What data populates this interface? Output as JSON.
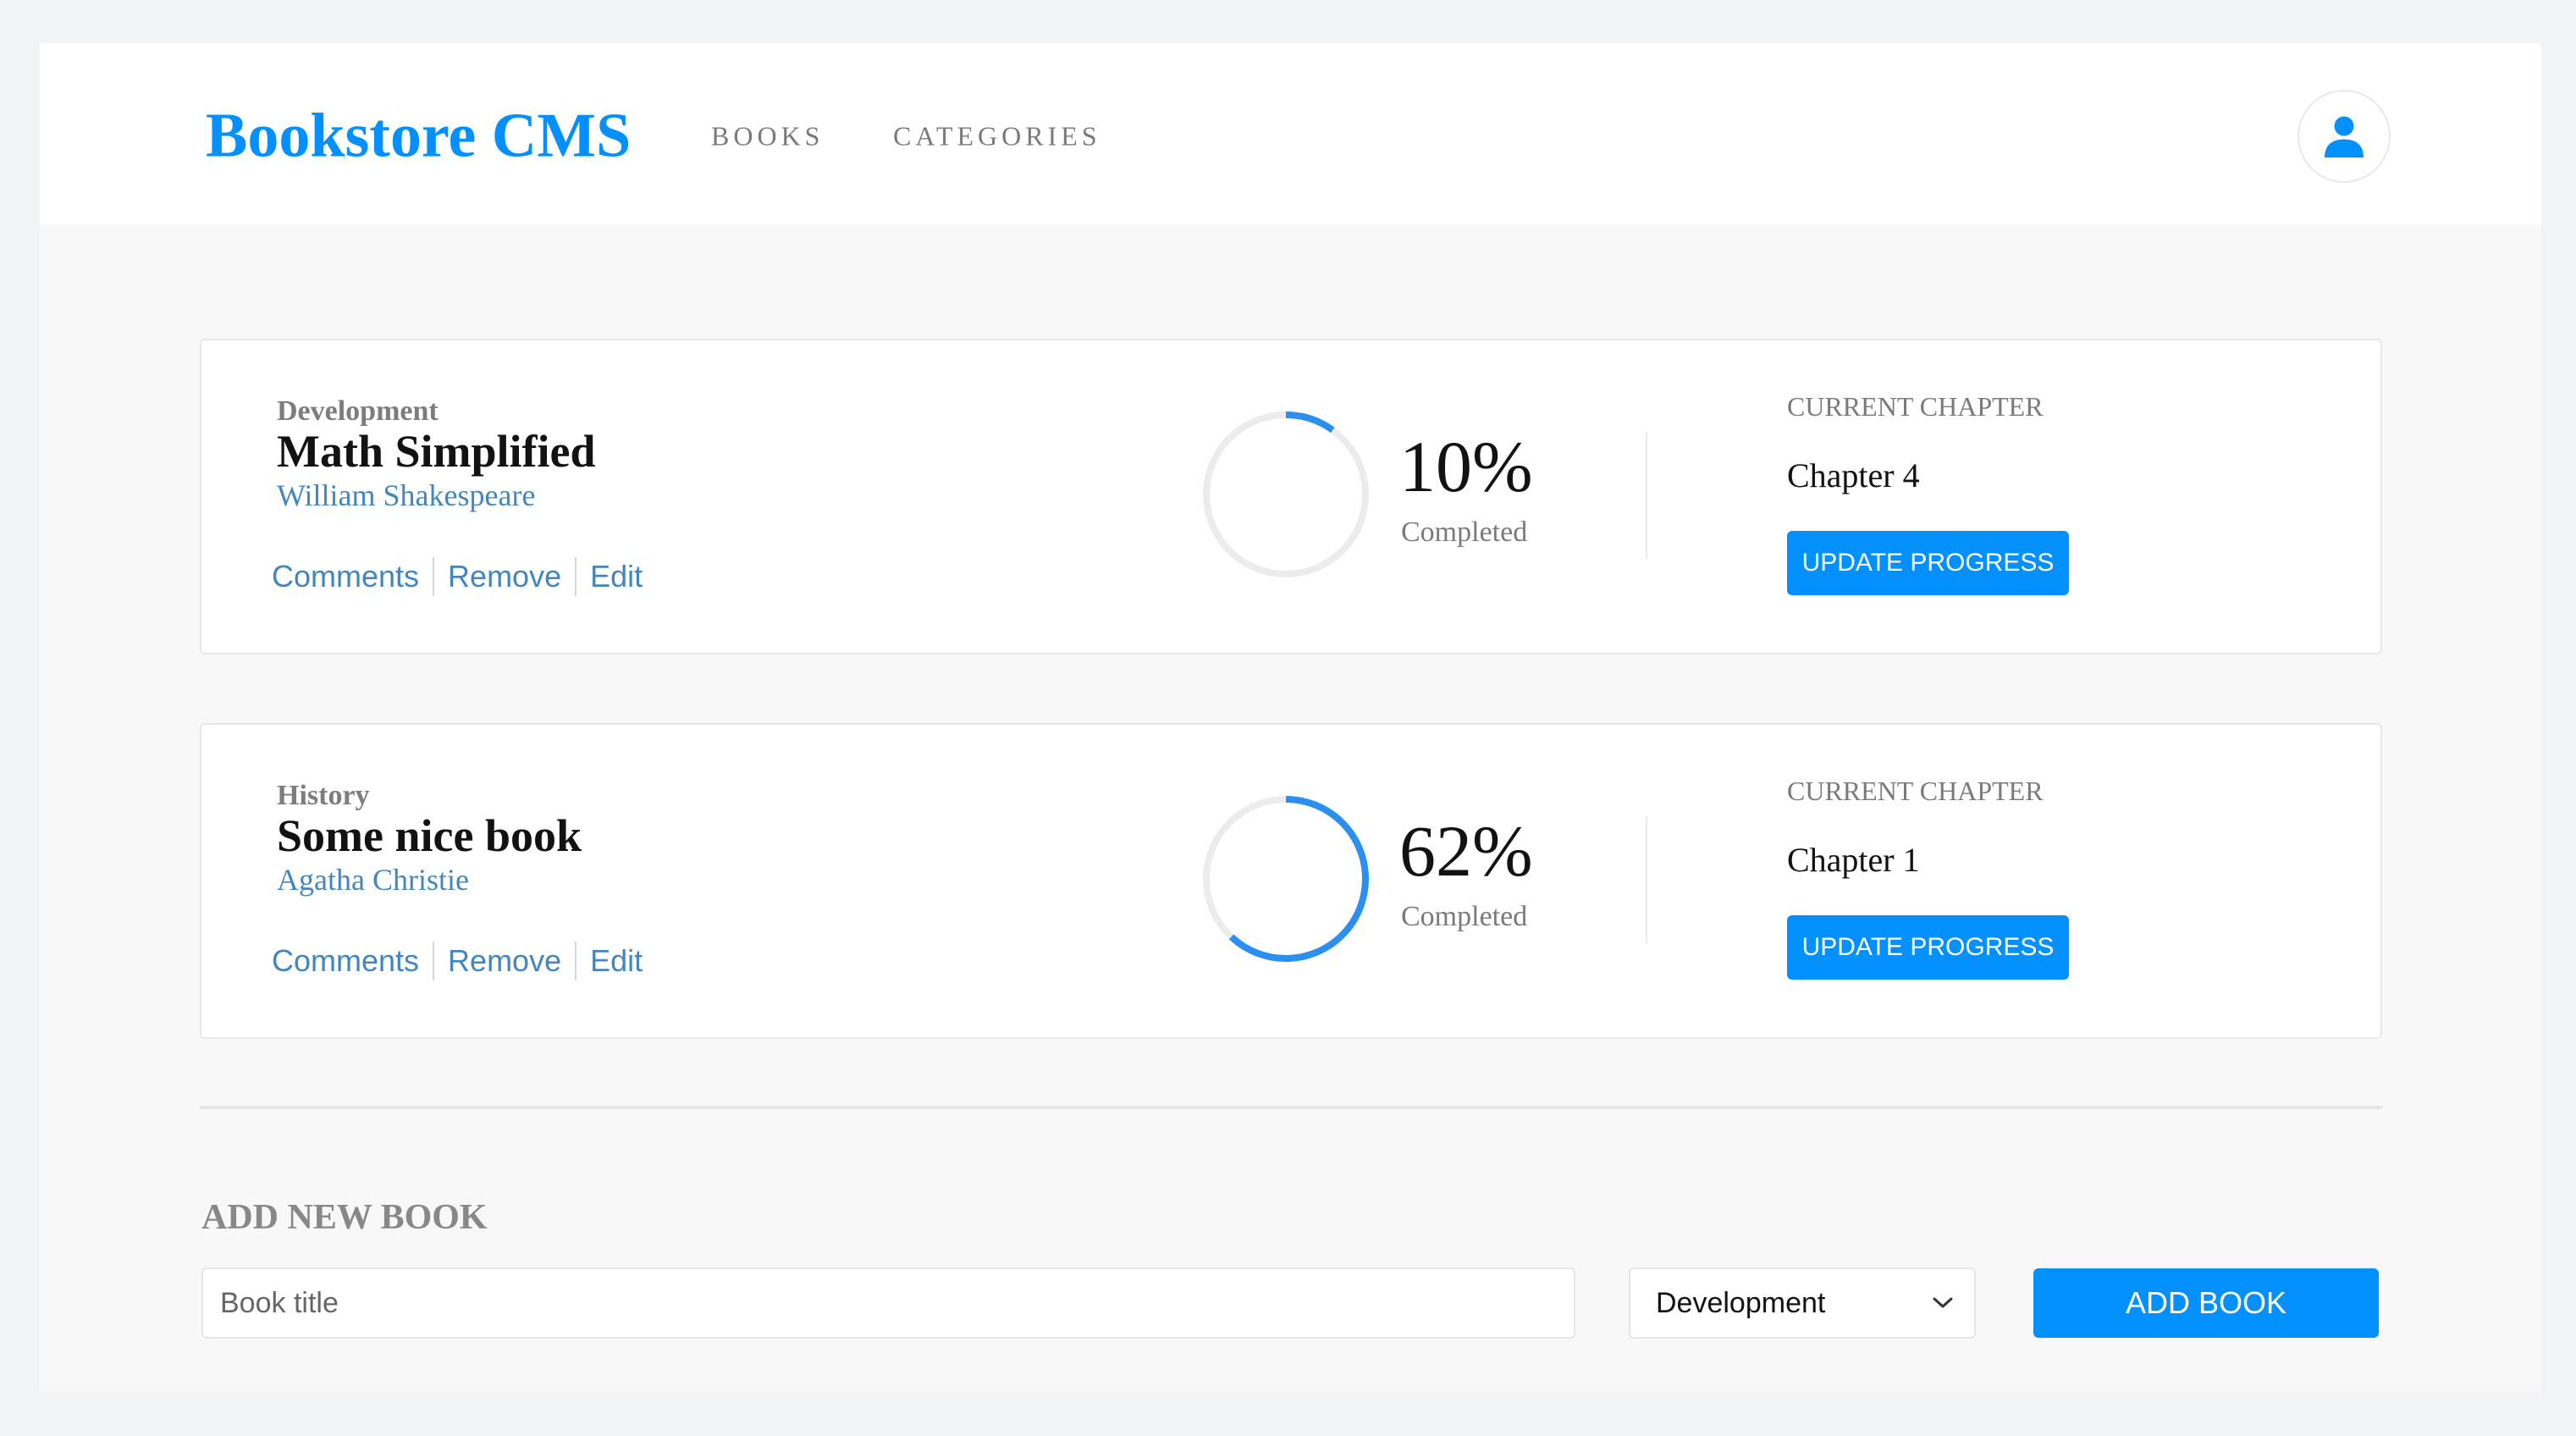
{
  "header": {
    "brand": "Bookstore CMS",
    "nav": [
      {
        "label": "BOOKS"
      },
      {
        "label": "CATEGORIES"
      }
    ],
    "avatar_icon": "user-icon"
  },
  "books": [
    {
      "category": "Development",
      "title": "Math Simplified",
      "author": "William Shakespeare",
      "actions": [
        "Comments",
        "Remove",
        "Edit"
      ],
      "progress_value": 10,
      "progress_text": "10%",
      "completed_label": "Completed",
      "chapter_label": "CURRENT CHAPTER",
      "chapter": "Chapter 4",
      "update_label": "UPDATE PROGRESS"
    },
    {
      "category": "History",
      "title": "Some nice book",
      "author": "Agatha Christie",
      "actions": [
        "Comments",
        "Remove",
        "Edit"
      ],
      "progress_value": 62,
      "progress_text": "62%",
      "completed_label": "Completed",
      "chapter_label": "CURRENT CHAPTER",
      "chapter": "Chapter 1",
      "update_label": "UPDATE PROGRESS"
    }
  ],
  "add_form": {
    "heading": "ADD NEW BOOK",
    "title_placeholder": "Book title",
    "title_value": "",
    "category_selected": "Development",
    "submit_label": "ADD BOOK"
  },
  "colors": {
    "accent": "#0290ff",
    "link": "#4386bf",
    "ring_track": "#ececec",
    "ring_fill": "#2b8fef"
  }
}
